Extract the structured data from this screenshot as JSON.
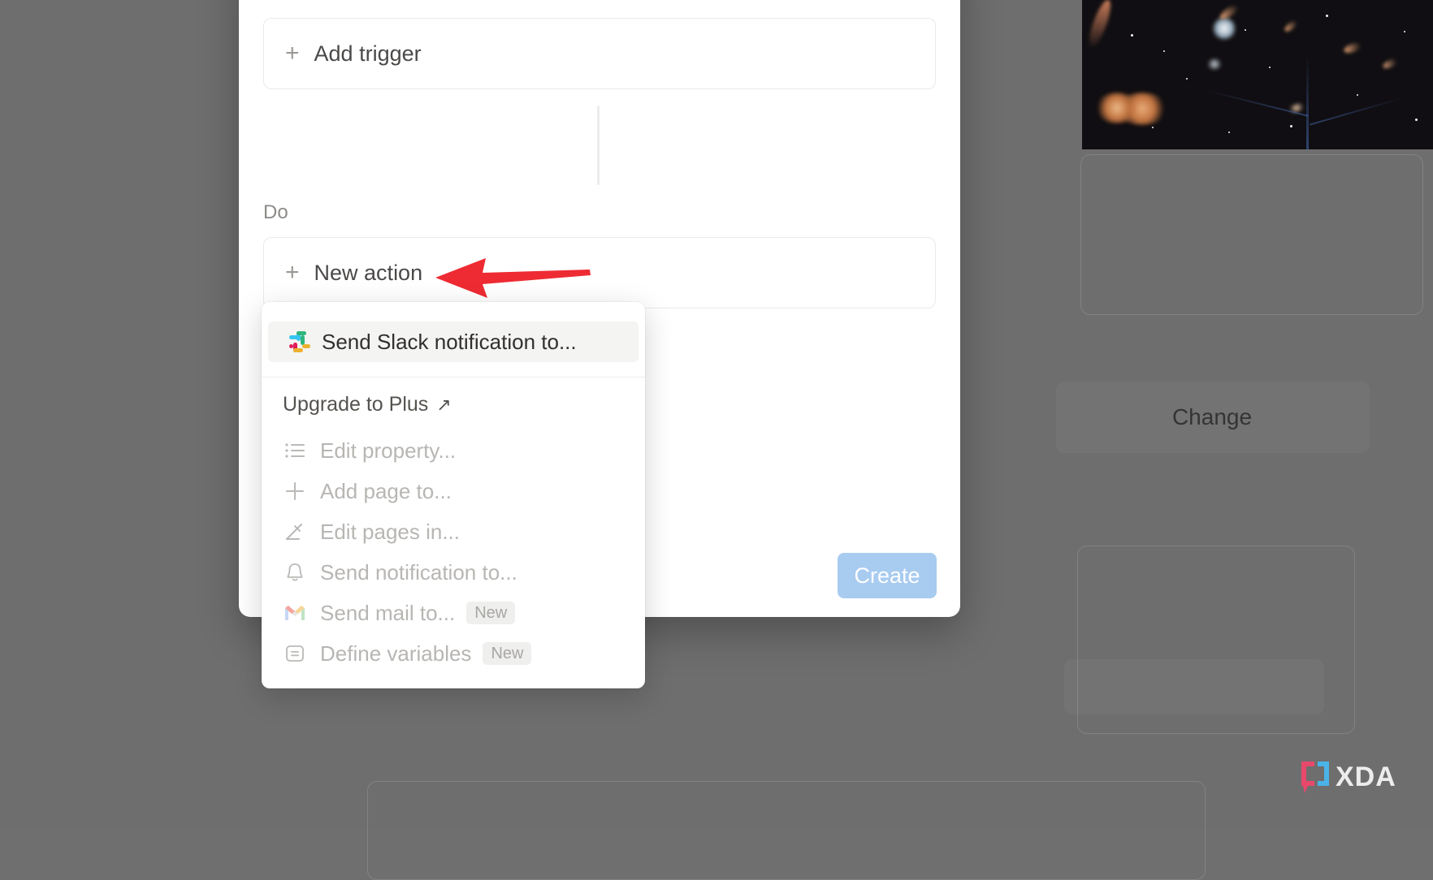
{
  "app": {
    "overlay_color": "#6e6e6e",
    "modal_background": "#ffffff"
  },
  "modal": {
    "flow": {
      "trigger_box": {
        "label": "Add trigger",
        "icon": "plus-icon"
      },
      "section_label": "Do",
      "action_box": {
        "label": "New action",
        "icon": "plus-icon"
      }
    },
    "create_button": {
      "label": "Create",
      "color": "#a8cbf0",
      "text_color": "#ffffff"
    }
  },
  "annotation": {
    "arrow": {
      "color": "#ee2b33",
      "direction": "left",
      "points_to": "New action"
    }
  },
  "dropdown": {
    "highlighted_item": {
      "label": "Send Slack notification to...",
      "icon": "slack-icon",
      "enabled": true
    },
    "upgrade": {
      "label": "Upgrade to Plus",
      "icon": "external-link-arrow-icon"
    },
    "items": [
      {
        "label": "Edit property...",
        "icon": "list-icon",
        "badge": null,
        "disabled": true
      },
      {
        "label": "Add page to...",
        "icon": "plus-icon",
        "badge": null,
        "disabled": true
      },
      {
        "label": "Edit pages in...",
        "icon": "pencil-icon",
        "badge": null,
        "disabled": true
      },
      {
        "label": "Send notification to...",
        "icon": "bell-icon",
        "badge": null,
        "disabled": true
      },
      {
        "label": "Send mail to...",
        "icon": "gmail-icon",
        "badge": "New",
        "disabled": true
      },
      {
        "label": "Define variables",
        "icon": "equals-box-icon",
        "badge": "New",
        "disabled": true
      }
    ]
  },
  "background": {
    "change_button": {
      "label": "Change"
    },
    "hero_image": {
      "name": "deep-space-galaxies-image"
    }
  },
  "watermark": {
    "label": "XDA",
    "bracket_left_color": "#e8486b",
    "bracket_right_color": "#4ab3e8"
  }
}
